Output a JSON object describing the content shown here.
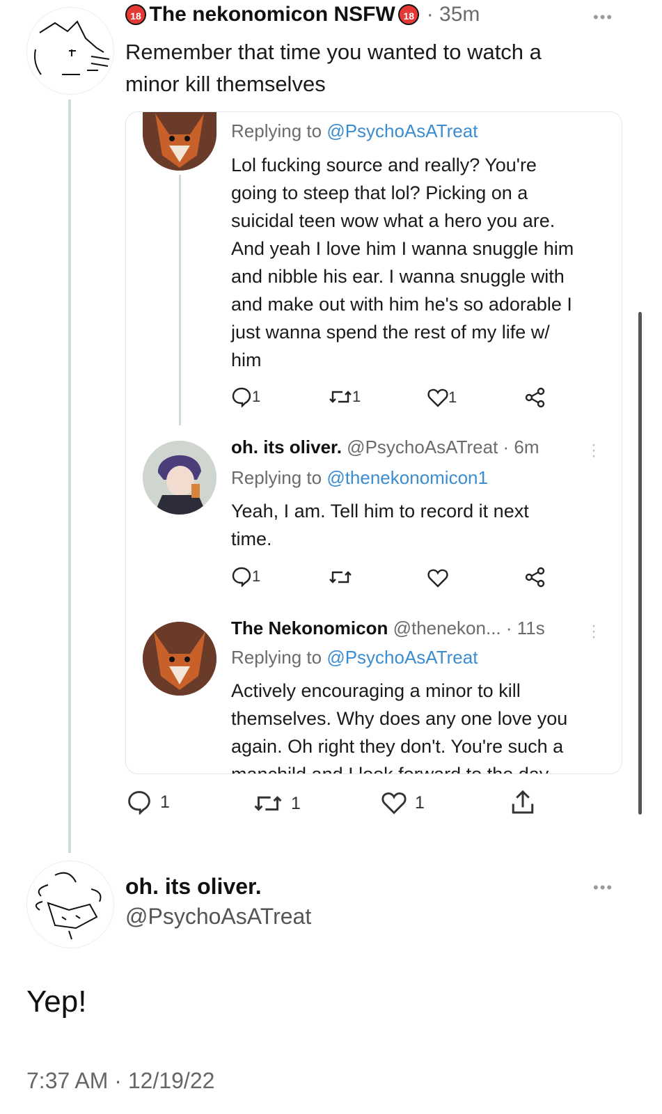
{
  "tweet": {
    "author": "The nekonomicon NSFW",
    "nsfw_badge": "18",
    "time": "· 35m",
    "text_line1": "Remember that time you wanted to watch a",
    "text_line2": "minor kill themselves",
    "more": "•••",
    "actions": {
      "reply_count": "1",
      "retweet_count": "1",
      "like_count": "1"
    }
  },
  "quote": {
    "reply1": {
      "replying_prefix": "Replying to",
      "replying_handle": "@PsychoAsATreat",
      "lines": [
        "Lol fucking source and really? You're",
        "going to steep that lol? Picking on a",
        "suicidal teen wow what a hero you are.",
        "And yeah I love him I wanna snuggle him",
        "and nibble his ear. I wanna snuggle with",
        "and make out with him he's so adorable I",
        "just wanna spend the rest of my life w/",
        "him"
      ],
      "reply_count": "1",
      "retweet_count": "1",
      "like_count": "1"
    },
    "reply2": {
      "name": "oh. its oliver.",
      "handle_time": "@PsychoAsATreat · 6m",
      "replying_prefix": "Replying to",
      "replying_handle": "@thenekonomicon1",
      "lines": [
        "Yeah, I am. Tell him to record it next",
        "time."
      ],
      "reply_count": "1"
    },
    "reply3": {
      "name": "The Nekonomicon",
      "handle_time": "@thenekon... · 11s",
      "replying_prefix": "Replying to",
      "replying_handle": "@PsychoAsATreat",
      "lines": [
        "Actively encouraging a minor to kill",
        "themselves. Why does any one love you",
        "again. Oh right they don't. You're such a",
        "manchild and I look forward to the day"
      ]
    }
  },
  "reply_tweet": {
    "name": "oh. its oliver.",
    "handle": "@PsychoAsATreat",
    "more": "•••",
    "text": "Yep!",
    "timestamp": "7:37 AM · 12/19/22"
  },
  "colors": {
    "link": "#3c8cd0",
    "nsfw_badge": "#e53935",
    "fox_orange": "#c8602a"
  }
}
